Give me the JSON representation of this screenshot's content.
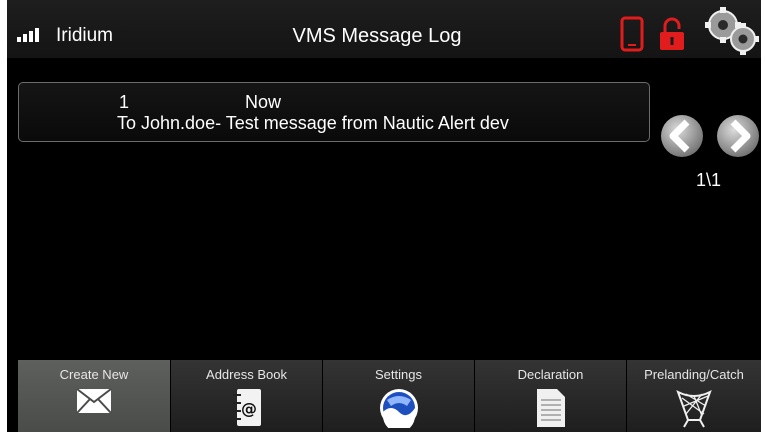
{
  "header": {
    "network_label": "Iridium",
    "title": "VMS Message Log",
    "icons": [
      "signal-icon",
      "phone-icon",
      "unlock-icon",
      "gear-icon"
    ]
  },
  "messages": [
    {
      "index": "1",
      "time": "Now",
      "text": "To John.doe- Test message from Nautic Alert dev"
    }
  ],
  "pagination": {
    "indicator": "1\\1"
  },
  "toolbar": {
    "buttons": [
      {
        "label": "Create New",
        "icon": "envelope-icon",
        "active": true
      },
      {
        "label": "Address Book",
        "icon": "address-book-icon",
        "active": false
      },
      {
        "label": "Settings",
        "icon": "noaa-icon",
        "active": false
      },
      {
        "label": "Declaration",
        "icon": "document-icon",
        "active": false
      },
      {
        "label": "Prelanding/Catch",
        "icon": "fishing-net-icon",
        "active": false
      }
    ]
  },
  "colors": {
    "accent_red": "#e11c1c",
    "background": "#000000",
    "active_button": "#545653"
  }
}
